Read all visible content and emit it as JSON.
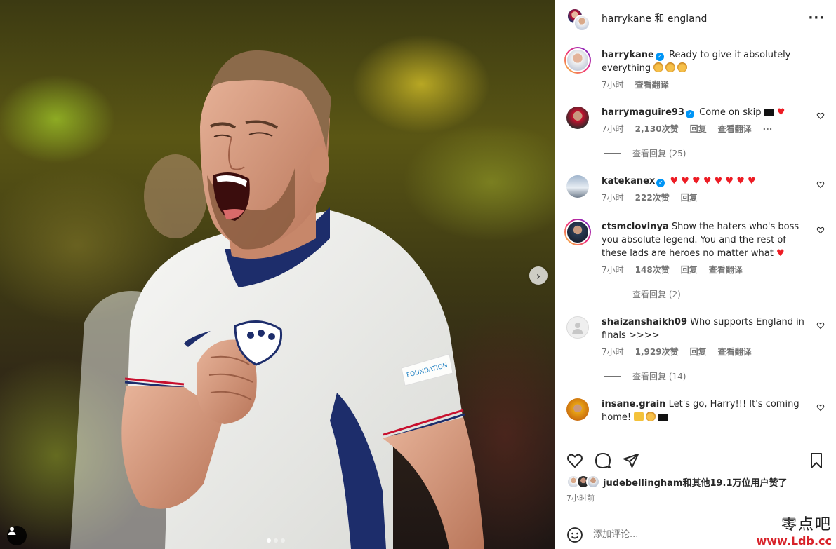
{
  "post": {
    "header_title": "harrykane 和 england",
    "more_label": "···",
    "nav_next_label": "›"
  },
  "caption": {
    "user": "harrykane",
    "text": "Ready to give it absolutely everything",
    "time": "7小时",
    "translate": "查看翻译"
  },
  "comments": [
    {
      "user": "harrymaguire93",
      "verified": true,
      "text": "Come on skip",
      "time": "7小时",
      "likes": "2,130次赞",
      "reply": "回复",
      "translate": "查看翻译",
      "more": "···",
      "view_replies": "查看回复 (25)"
    },
    {
      "user": "katekanex",
      "verified": true,
      "text": "",
      "time": "7小时",
      "likes": "222次赞",
      "reply": "回复"
    },
    {
      "user": "ctsmclovinya",
      "verified": false,
      "text": "Show the haters who's boss you absolute legend. You and the rest of these lads are heroes no matter what",
      "time": "7小时",
      "likes": "148次赞",
      "reply": "回复",
      "translate": "查看翻译",
      "view_replies": "查看回复 (2)"
    },
    {
      "user": "shaizanshaikh09",
      "verified": false,
      "text": "Who supports England in finals >>>>",
      "time": "7小时",
      "likes": "1,929次赞",
      "reply": "回复",
      "translate": "查看翻译",
      "view_replies": "查看回复 (14)"
    },
    {
      "user": "insane.grain",
      "verified": false,
      "text": "Let's go, Harry!!! It's coming home!",
      "time": "",
      "likes": "",
      "reply": ""
    }
  ],
  "likes": {
    "text": "judebellingham和其他19.1万位用户赞了",
    "time": "7小时前"
  },
  "comment_input": {
    "placeholder": "添加评论..."
  },
  "watermark": {
    "line1": "零点吧",
    "line2": "www.Ldb.cc"
  },
  "colors": {
    "verified": "#0095f6",
    "heart": "#ed1c24",
    "link_text": "#737373",
    "england_navy": "#1d2d6b"
  },
  "carousel": {
    "count": 3,
    "active": 0
  }
}
